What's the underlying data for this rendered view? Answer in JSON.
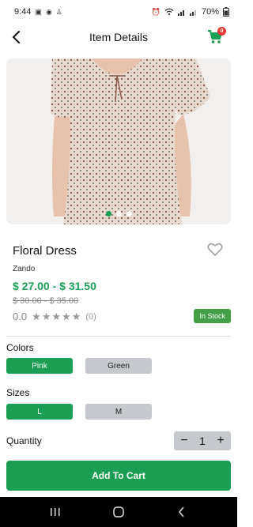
{
  "status_bar": {
    "time": "9:44",
    "battery": "70%",
    "left_icons": [
      "image-icon",
      "messenger-icon",
      "snapchat-icon"
    ],
    "right_icons": [
      "alarm-icon",
      "wifi-icon",
      "signal-icon",
      "signal-icon"
    ]
  },
  "header": {
    "title": "Item Details",
    "cart_count": "0"
  },
  "colors_theme": {
    "accent": "#1a9f55",
    "stock": "#43a047",
    "badge": "#e53935",
    "chip_unselected": "#c5c8cc"
  },
  "carousel": {
    "slide_count": 3,
    "active_index": 0
  },
  "product": {
    "name": "Floral Dress",
    "brand": "Zando",
    "price_range": "$ 27.00 - $ 31.50",
    "old_price_range": "$ 30.00 - $ 35.00",
    "rating": "0.0",
    "rating_count": "(0)",
    "stars_filled": 0,
    "stars_total": 5,
    "stock_status": "In Stock"
  },
  "colors_section": {
    "label": "Colors",
    "options": [
      "Pink",
      "Green"
    ],
    "selected": "Pink"
  },
  "sizes_section": {
    "label": "Sizes",
    "options": [
      "L",
      "M"
    ],
    "selected": "L"
  },
  "quantity": {
    "label": "Quantity",
    "value": "1",
    "minus": "−",
    "plus": "+"
  },
  "actions": {
    "add_to_cart": "Add To Cart"
  }
}
